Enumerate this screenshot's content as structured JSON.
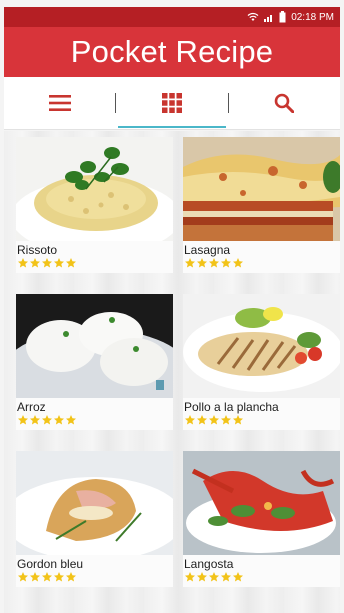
{
  "status_bar": {
    "time": "02:18 PM"
  },
  "header": {
    "title": "Pocket Recipe"
  },
  "tabs": [
    {
      "icon": "hamburger-menu-icon"
    },
    {
      "icon": "grid-icon",
      "active": true
    },
    {
      "icon": "search-icon"
    }
  ],
  "colors": {
    "header": "#d8343a",
    "status_bar": "#b51f24",
    "tab_icon": "#c8352f",
    "accent": "#4bb7c9",
    "star": "#f2c318"
  },
  "recipes": [
    {
      "name": "Rissoto",
      "rating": 5
    },
    {
      "name": "Lasagna",
      "rating": 5
    },
    {
      "name": "Arroz",
      "rating": 5
    },
    {
      "name": "Pollo a la plancha",
      "rating": 5
    },
    {
      "name": "Gordon bleu",
      "rating": 5
    },
    {
      "name": "Langosta",
      "rating": 5
    }
  ]
}
